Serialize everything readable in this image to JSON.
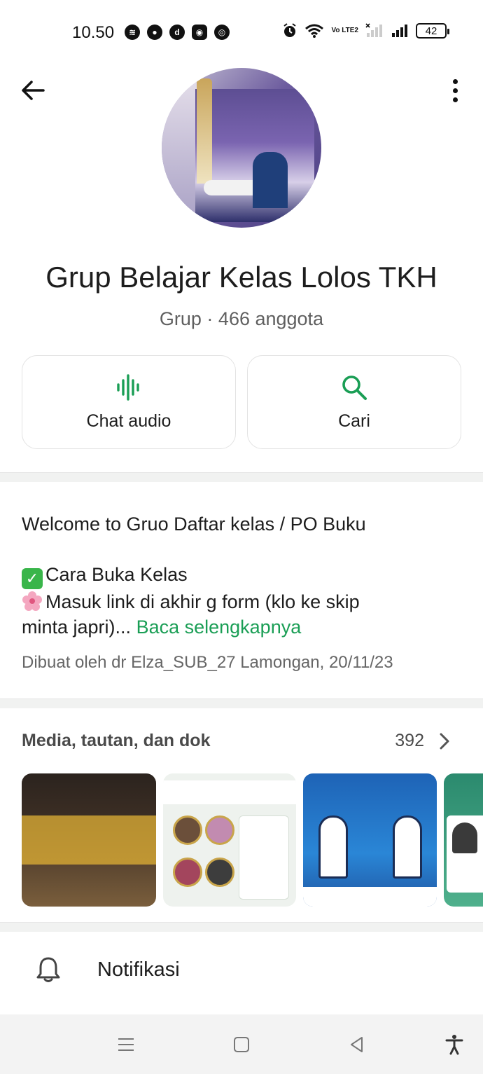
{
  "status_bar": {
    "time": "10.50",
    "volte": "Vo LTE2",
    "battery": "42"
  },
  "header": {
    "back_icon": "arrow-left-icon",
    "more_icon": "more-vertical-icon"
  },
  "group": {
    "name": "Grup Belajar Kelas Lolos TKH",
    "meta": "Grup · 466 anggota"
  },
  "actions": [
    {
      "label": "Chat audio",
      "icon": "audio-wave-icon"
    },
    {
      "label": "Cari",
      "icon": "search-icon"
    }
  ],
  "description": {
    "line1": "Welcome to Gruo Daftar kelas / PO Buku",
    "line2": "Cara Buka Kelas",
    "line3": "Masuk link di akhir g form (klo ke skip",
    "line4": "minta japri)...",
    "read_more": "Baca selengkapnya",
    "created_by": "Dibuat oleh dr Elza_SUB_27 Lamongan, 20/11/23"
  },
  "media": {
    "title": "Media, tautan, dan dok",
    "count": "392"
  },
  "notifications": {
    "label": "Notifikasi"
  },
  "colors": {
    "accent_green": "#1a9e55",
    "separator": "#f1f2f1"
  }
}
